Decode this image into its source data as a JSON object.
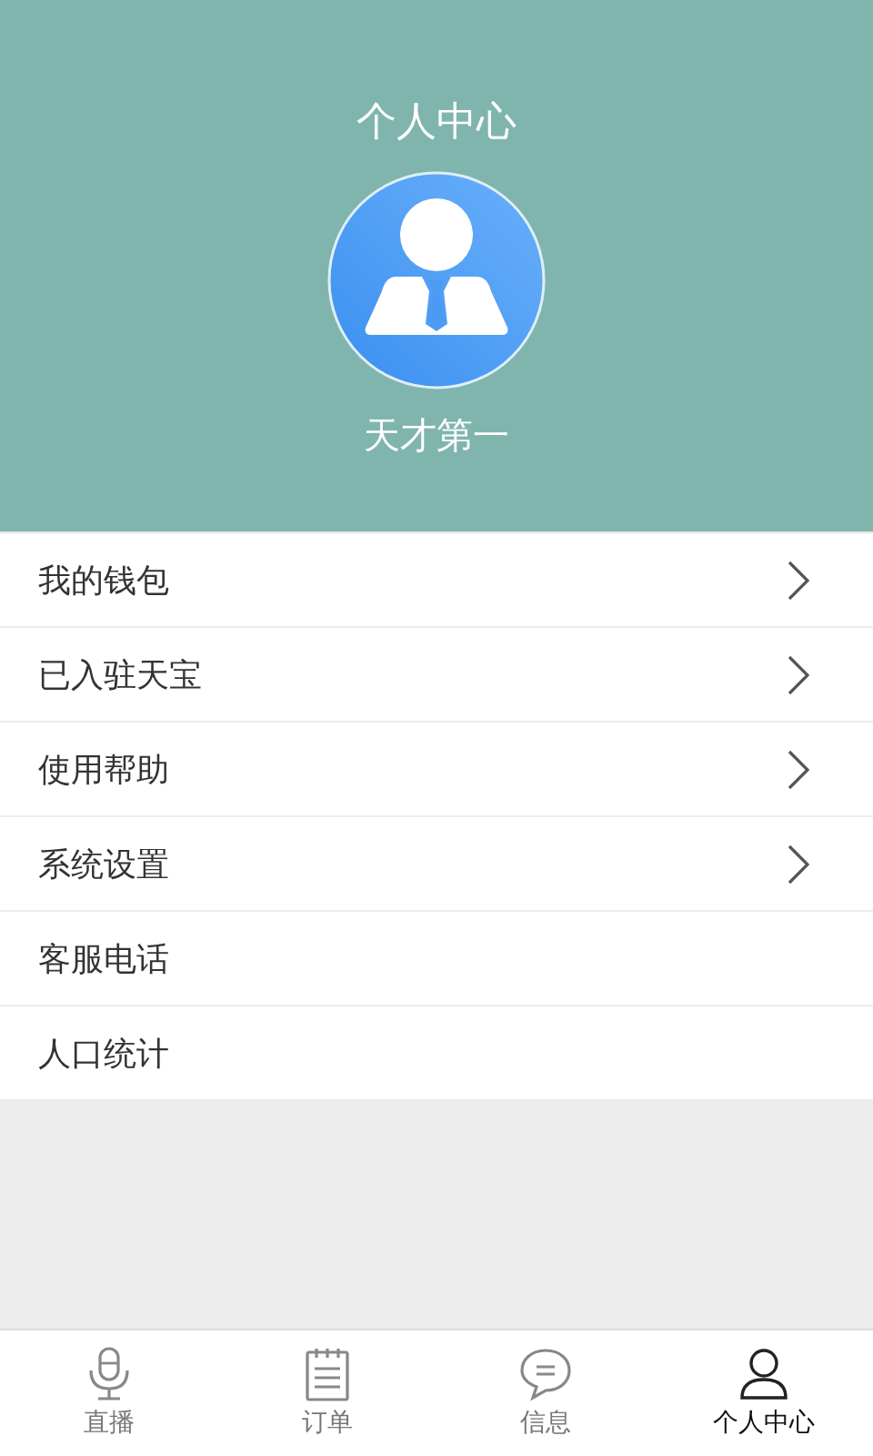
{
  "header": {
    "title": "个人中心",
    "username": "天才第一"
  },
  "menu": [
    {
      "label": "我的钱包",
      "arrow": true
    },
    {
      "label": "已入驻天宝",
      "arrow": true
    },
    {
      "label": "使用帮助",
      "arrow": true
    },
    {
      "label": "系统设置",
      "arrow": true
    },
    {
      "label": "客服电话",
      "arrow": false
    },
    {
      "label": "人口统计",
      "arrow": false
    }
  ],
  "tabs": [
    {
      "label": "直播",
      "kind": "mic",
      "selected": false
    },
    {
      "label": "订单",
      "kind": "notepad",
      "selected": false
    },
    {
      "label": "信息",
      "kind": "chat",
      "selected": false
    },
    {
      "label": "个人中心",
      "kind": "person",
      "selected": true
    }
  ]
}
